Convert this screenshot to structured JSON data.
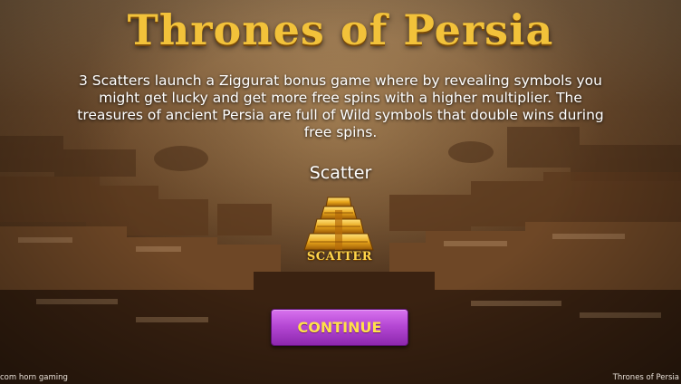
{
  "game": {
    "title": "Thrones of Persia",
    "description": "3 Scatters launch a Ziggurat bonus game where by revealing symbols you might get lucky and get more free spins with a higher multiplier. The treasures of ancient Persia are full of Wild symbols that double wins during free spins.",
    "symbol_heading": "Scatter",
    "symbol_icon": "ziggurat-icon",
    "symbol_icon_text": "SCATTER",
    "continue_label": "CONTINUE",
    "footer_left": "com horn gaming",
    "footer_right": "Thrones of Persia"
  },
  "colors": {
    "title_gold": "#f2c23a",
    "button_purple": "#b548d4",
    "button_text": "#ffe04a"
  }
}
